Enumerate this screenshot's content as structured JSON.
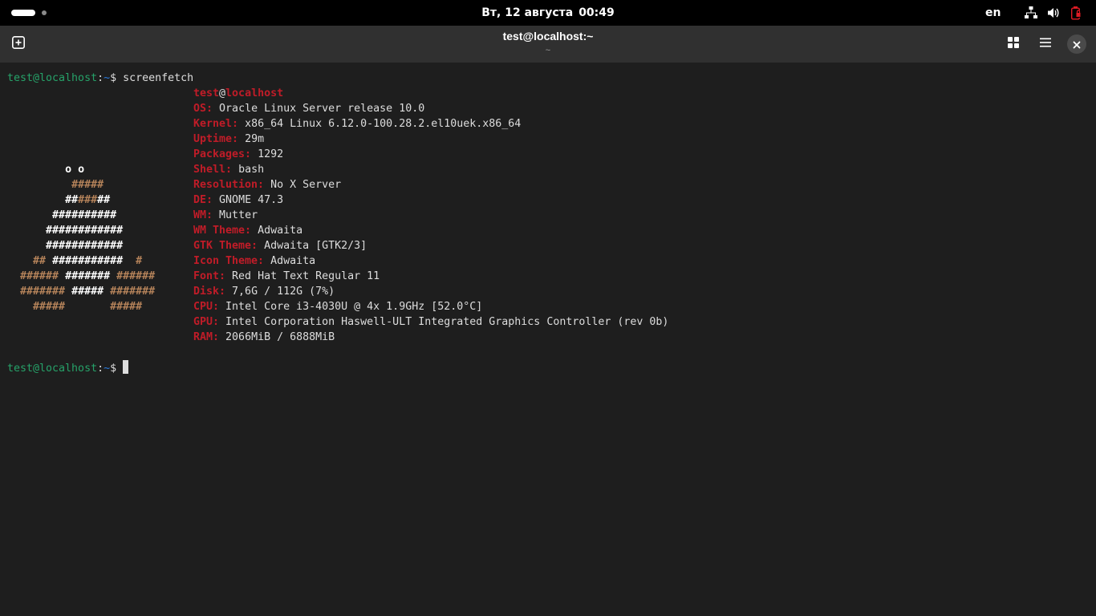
{
  "topbar": {
    "date": "Вт, 12 августа",
    "time": "00:49",
    "keyboard_layout": "en",
    "icons": [
      "network-icon",
      "volume-icon",
      "battery-icon"
    ]
  },
  "headerbar": {
    "title": "test@localhost:~",
    "subtitle": "~",
    "icons": [
      "new-tab-icon",
      "grid-icon",
      "hamburger-menu-icon",
      "close-icon"
    ]
  },
  "terminal": {
    "prompt": {
      "user": "test@localhost",
      "colon": ":",
      "path": "~",
      "dollar": "$ "
    },
    "command": "screenfetch",
    "info_header": {
      "user": "test",
      "at": "@",
      "host": "localhost"
    },
    "info": [
      {
        "label": "OS:",
        "value": "Oracle Linux Server release 10.0"
      },
      {
        "label": "Kernel:",
        "value": "x86_64 Linux 6.12.0-100.28.2.el10uek.x86_64"
      },
      {
        "label": "Uptime:",
        "value": "29m"
      },
      {
        "label": "Packages:",
        "value": "1292"
      },
      {
        "label": "Shell:",
        "value": "bash"
      },
      {
        "label": "Resolution:",
        "value": "No X Server"
      },
      {
        "label": "DE:",
        "value": "GNOME 47.3"
      },
      {
        "label": "WM:",
        "value": "Mutter"
      },
      {
        "label": "WM Theme:",
        "value": "Adwaita"
      },
      {
        "label": "GTK Theme:",
        "value": "Adwaita [GTK2/3]"
      },
      {
        "label": "Icon Theme:",
        "value": "Adwaita"
      },
      {
        "label": "Font:",
        "value": "Red Hat Text Regular 11"
      },
      {
        "label": "Disk:",
        "value": "7,6G / 112G (7%)"
      },
      {
        "label": "CPU:",
        "value": "Intel Core i3-4030U @ 4x 1.9GHz [52.0°C]"
      },
      {
        "label": "GPU:",
        "value": "Intel Corporation Haswell-ULT Integrated Graphics Controller (rev 0b)"
      },
      {
        "label": "RAM:",
        "value": "2066MiB / 6888MiB"
      }
    ],
    "ascii_art": [
      [
        {
          "t": "         ",
          "c": "w"
        },
        {
          "t": "o o",
          "c": "w"
        }
      ],
      [
        {
          "t": "          ",
          "c": "w"
        },
        {
          "t": "#####",
          "c": "b"
        }
      ],
      [
        {
          "t": "         ",
          "c": "w"
        },
        {
          "t": "##",
          "c": "w"
        },
        {
          "t": "###",
          "c": "b"
        },
        {
          "t": "##",
          "c": "w"
        }
      ],
      [
        {
          "t": "       ",
          "c": "w"
        },
        {
          "t": "##########",
          "c": "w"
        }
      ],
      [
        {
          "t": "      ",
          "c": "w"
        },
        {
          "t": "############",
          "c": "w"
        }
      ],
      [
        {
          "t": "      ",
          "c": "w"
        },
        {
          "t": "############",
          "c": "w"
        }
      ],
      [
        {
          "t": "    ",
          "c": "w"
        },
        {
          "t": "##",
          "c": "b"
        },
        {
          "t": " ",
          "c": "w"
        },
        {
          "t": "###########",
          "c": "w"
        },
        {
          "t": "  ",
          "c": "w"
        },
        {
          "t": "#",
          "c": "b"
        }
      ],
      [
        {
          "t": "  ",
          "c": "w"
        },
        {
          "t": "######",
          "c": "b"
        },
        {
          "t": " ",
          "c": "w"
        },
        {
          "t": "#######",
          "c": "w"
        },
        {
          "t": " ",
          "c": "w"
        },
        {
          "t": "######",
          "c": "b"
        }
      ],
      [
        {
          "t": "  ",
          "c": "w"
        },
        {
          "t": "#######",
          "c": "b"
        },
        {
          "t": " ",
          "c": "w"
        },
        {
          "t": "#####",
          "c": "w"
        },
        {
          "t": " ",
          "c": "w"
        },
        {
          "t": "#######",
          "c": "b"
        }
      ],
      [
        {
          "t": "    ",
          "c": "w"
        },
        {
          "t": "#####",
          "c": "b"
        },
        {
          "t": "       ",
          "c": "w"
        },
        {
          "t": "#####",
          "c": "b"
        }
      ]
    ]
  }
}
